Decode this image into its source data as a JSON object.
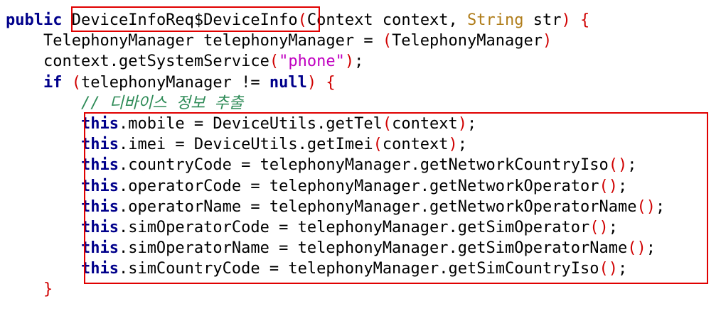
{
  "code": {
    "line1": {
      "kw_public": "public",
      "method_name": "DeviceInfoReq$DeviceInfo",
      "open_paren": "(",
      "param1": "Context context, ",
      "string_type": "String",
      "param2": " str",
      "close_paren": ")",
      "space": " ",
      "brace_open": "{"
    },
    "line2": {
      "indent": "    ",
      "decl": "TelephonyManager telephonyManager = ",
      "open_paren": "(",
      "cast": "TelephonyManager",
      "close_paren": ")"
    },
    "line3": {
      "indent": "    ",
      "call": "context.getSystemService",
      "open_paren": "(",
      "arg": "\"phone\"",
      "close_paren": ")",
      "end": ";"
    },
    "line4": {
      "indent": "    ",
      "kw_if": "if",
      "space": " ",
      "open_paren": "(",
      "cond": "telephonyManager != ",
      "kw_null": "null",
      "close_paren": ")",
      "space2": " ",
      "brace_open": "{"
    },
    "line5": {
      "indent": "        ",
      "comment": "// 디바이스 정보 추출"
    },
    "assignments": [
      {
        "field": ".mobile = DeviceUtils.getTel",
        "args": "context"
      },
      {
        "field": ".imei = DeviceUtils.getImei",
        "args": "context"
      },
      {
        "field": ".countryCode = telephonyManager.getNetworkCountryIso",
        "args": ""
      },
      {
        "field": ".operatorCode = telephonyManager.getNetworkOperator",
        "args": ""
      },
      {
        "field": ".operatorName = telephonyManager.getNetworkOperatorName",
        "args": ""
      },
      {
        "field": ".simOperatorCode = telephonyManager.getSimOperator",
        "args": ""
      },
      {
        "field": ".simOperatorName = telephonyManager.getSimOperatorName",
        "args": ""
      },
      {
        "field": ".simCountryCode = telephonyManager.getSimCountryIso",
        "args": ""
      }
    ],
    "kw_this": "this",
    "indent8": "        ",
    "open_paren": "(",
    "close_paren": ")",
    "semicolon": ";",
    "closing_brace_line": {
      "indent": "    ",
      "brace_close": "}"
    }
  },
  "colors": {
    "keyword": "#00008b",
    "type": "#b07d1a",
    "string": "#c000c0",
    "paren": "#d00000",
    "comment": "#2e8b57",
    "highlight_box": "#e00000"
  }
}
